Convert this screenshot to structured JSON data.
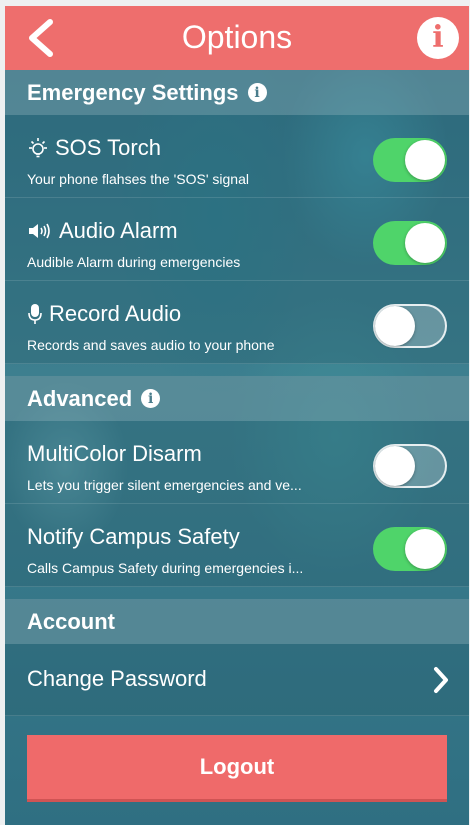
{
  "header": {
    "title": "Options",
    "info_glyph": "i"
  },
  "sections": {
    "emergency": {
      "title": "Emergency Settings",
      "info_glyph": "i"
    },
    "advanced": {
      "title": "Advanced",
      "info_glyph": "i"
    },
    "account": {
      "title": "Account"
    }
  },
  "settings": [
    {
      "icon": "bulb-icon",
      "title": "SOS Torch",
      "subtitle": "Your phone flahses the 'SOS' signal",
      "enabled": true
    },
    {
      "icon": "speaker-icon",
      "title": "Audio Alarm",
      "subtitle": "Audible Alarm during emergencies",
      "enabled": true
    },
    {
      "icon": "microphone-icon",
      "title": "Record Audio",
      "subtitle": "Records and saves audio to your phone",
      "enabled": false
    },
    {
      "title": "MultiColor Disarm",
      "subtitle": "Lets you trigger silent emergencies and ve...",
      "enabled": false
    },
    {
      "title": "Notify Campus Safety",
      "subtitle": "Calls Campus Safety during emergencies i...",
      "enabled": true
    }
  ],
  "account": {
    "change_password_label": "Change Password"
  },
  "logout_label": "Logout",
  "colors": {
    "header": "#ee6e6d",
    "toggle_on": "#4fd46a",
    "logout": "#ef6a6a"
  }
}
